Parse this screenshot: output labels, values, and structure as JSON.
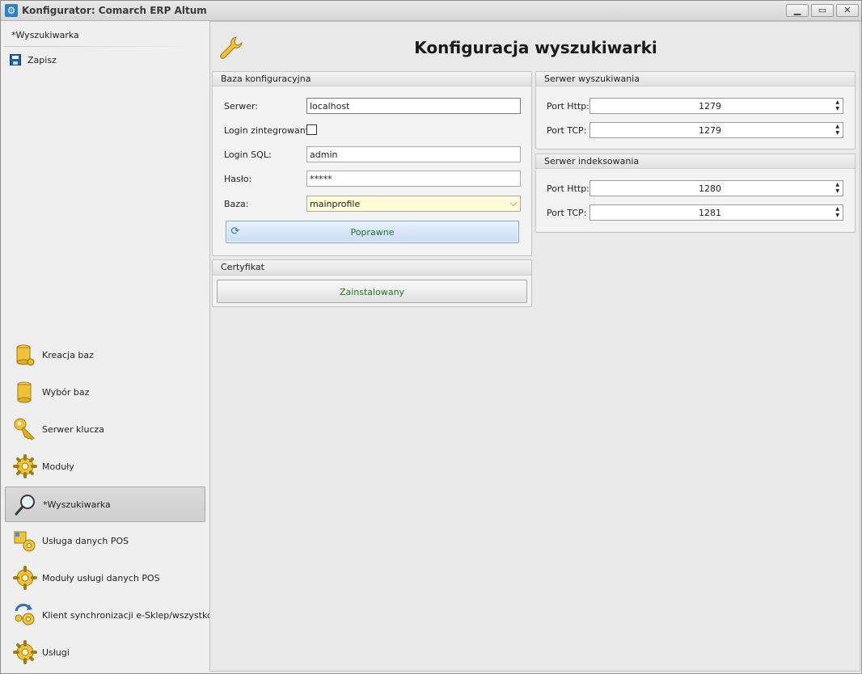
{
  "window": {
    "title": "Konfigurator: Comarch ERP Altum"
  },
  "sidebar": {
    "header": "*Wyszukiwarka",
    "save_label": "Zapisz",
    "items": [
      {
        "label": "Kreacja baz",
        "icon": "database-gear-icon"
      },
      {
        "label": "Wybór baz",
        "icon": "database-icon"
      },
      {
        "label": "Serwer klucza",
        "icon": "key-icon"
      },
      {
        "label": "Moduły",
        "icon": "gear-icon"
      },
      {
        "label": "*Wyszukiwarka",
        "icon": "magnifier-icon",
        "active": true
      },
      {
        "label": "Usługa danych POS",
        "icon": "pos-data-service-icon"
      },
      {
        "label": "Moduły usługi danych POS",
        "icon": "gear-icon"
      },
      {
        "label": "Klient synchronizacji e-Sklep/wszystko.pl",
        "icon": "sync-gear-icon"
      },
      {
        "label": "Usługi",
        "icon": "gear-icon"
      }
    ]
  },
  "main": {
    "title": "Konfiguracja wyszukiwarki",
    "baza_konfiguracyjna": {
      "title": "Baza konfiguracyjna",
      "serwer_label": "Serwer:",
      "serwer_value": "localhost",
      "login_zint_label": "Login zintegrowany:",
      "login_zint_checked": false,
      "login_sql_label": "Login SQL:",
      "login_sql_value": "admin",
      "haslo_label": "Hasło:",
      "haslo_value": "*****",
      "baza_label": "Baza:",
      "baza_value": "mainprofile",
      "status_button": "Poprawne"
    },
    "certyfikat": {
      "title": "Certyfikat",
      "button": "Zainstalowany"
    },
    "serwer_wyszukiwania": {
      "title": "Serwer wyszukiwania",
      "http_label": "Port Http:",
      "http_value": "1279",
      "tcp_label": "Port TCP:",
      "tcp_value": "1279"
    },
    "serwer_indeksowania": {
      "title": "Serwer indeksowania",
      "http_label": "Port Http:",
      "http_value": "1280",
      "tcp_label": "Port TCP:",
      "tcp_value": "1281"
    }
  },
  "colors": {
    "status_text": "#1f7a1f",
    "accent_blue": "#c9dcf7",
    "highlight_yellow": "#fffbd9"
  }
}
